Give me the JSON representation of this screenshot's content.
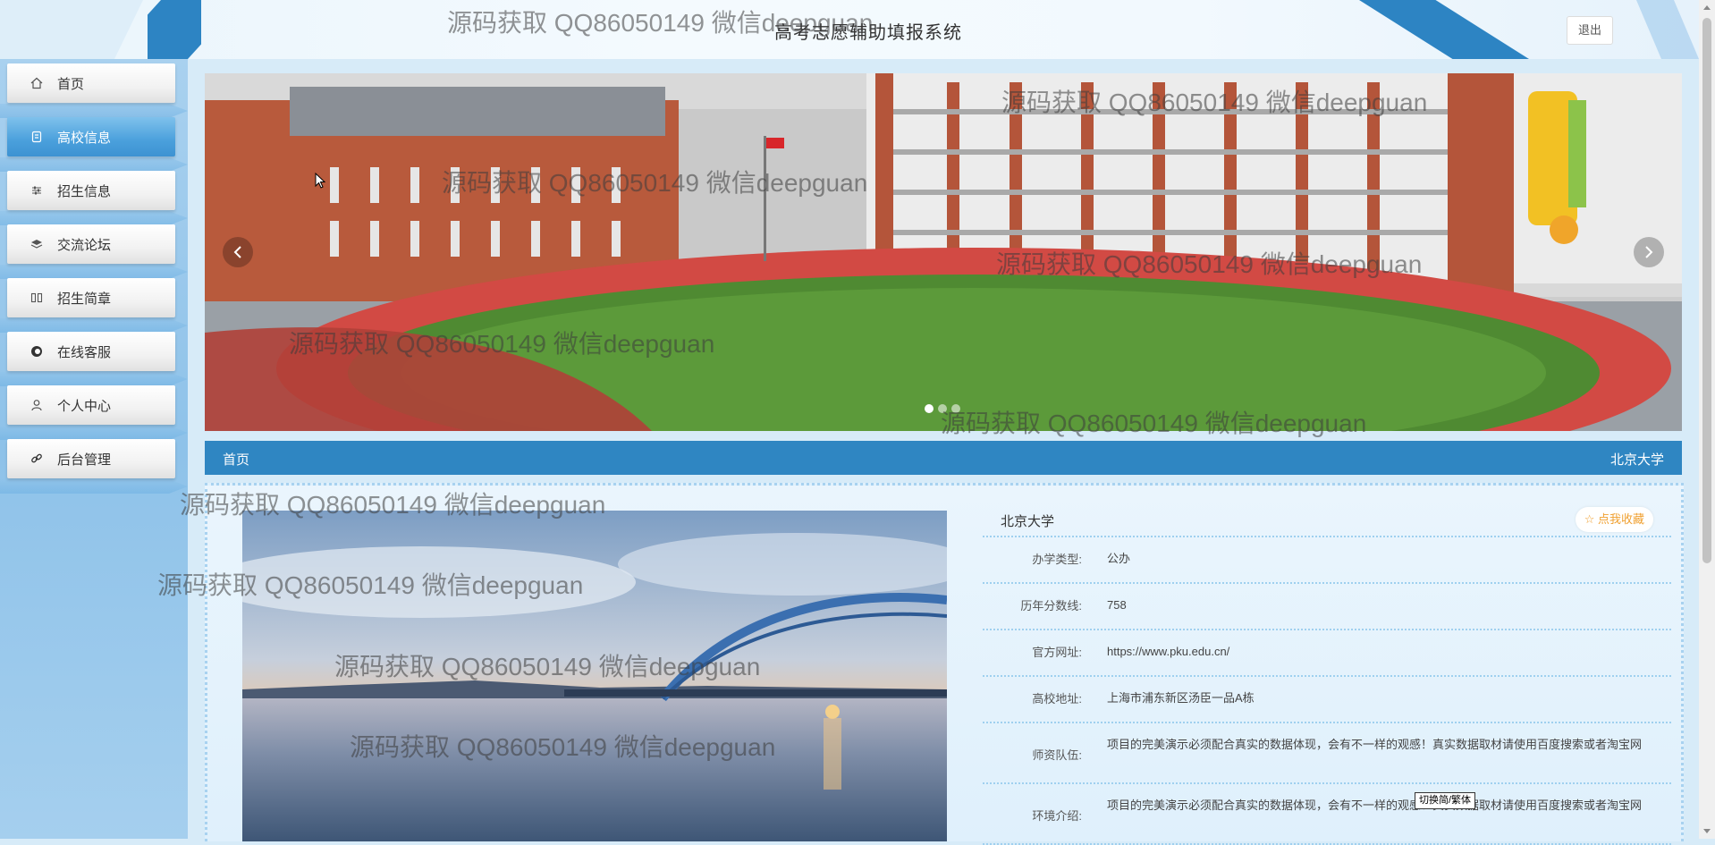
{
  "header": {
    "title": "高考志愿辅助填报系统",
    "logout_label": "退出"
  },
  "sidebar": {
    "items": [
      {
        "label": "首页",
        "icon": "home-icon"
      },
      {
        "label": "高校信息",
        "icon": "document-icon",
        "active": true
      },
      {
        "label": "招生信息",
        "icon": "sliders-icon"
      },
      {
        "label": "交流论坛",
        "icon": "layers-icon"
      },
      {
        "label": "招生简章",
        "icon": "columns-icon"
      },
      {
        "label": "在线客服",
        "icon": "chat-icon"
      },
      {
        "label": "个人中心",
        "icon": "user-icon"
      },
      {
        "label": "后台管理",
        "icon": "link-icon"
      }
    ]
  },
  "banner": {
    "slide_count": 3,
    "active_slide": 1
  },
  "breadcrumb": {
    "home": "首页",
    "current": "北京大学"
  },
  "detail": {
    "name": "北京大学",
    "favorite_label": "☆ 点我收藏",
    "fields": [
      {
        "label": "办学类型:",
        "value": "公办"
      },
      {
        "label": "历年分数线:",
        "value": "758"
      },
      {
        "label": "官方网址:",
        "value": "https://www.pku.edu.cn/"
      },
      {
        "label": "高校地址:",
        "value": "上海市浦东新区汤臣一品A栋"
      },
      {
        "label": "师资队伍:",
        "value": "项目的完美演示必须配合真实的数据体现，会有不一样的观感！真实数据取材请使用百度搜索或者淘宝网"
      },
      {
        "label": "环境介绍:",
        "value": "项目的完美演示必须配合真实的数据体现，会有不一样的观感！真实数据取材请使用百度搜索或者淘宝网"
      }
    ]
  },
  "watermark": "源码获取 QQ86050149 微信deepguan",
  "toggle_label": "切换简/繁体",
  "colors": {
    "accent": "#2f86c2",
    "sidebar_active": "#4aa0dc",
    "favorite": "#f0a030"
  }
}
